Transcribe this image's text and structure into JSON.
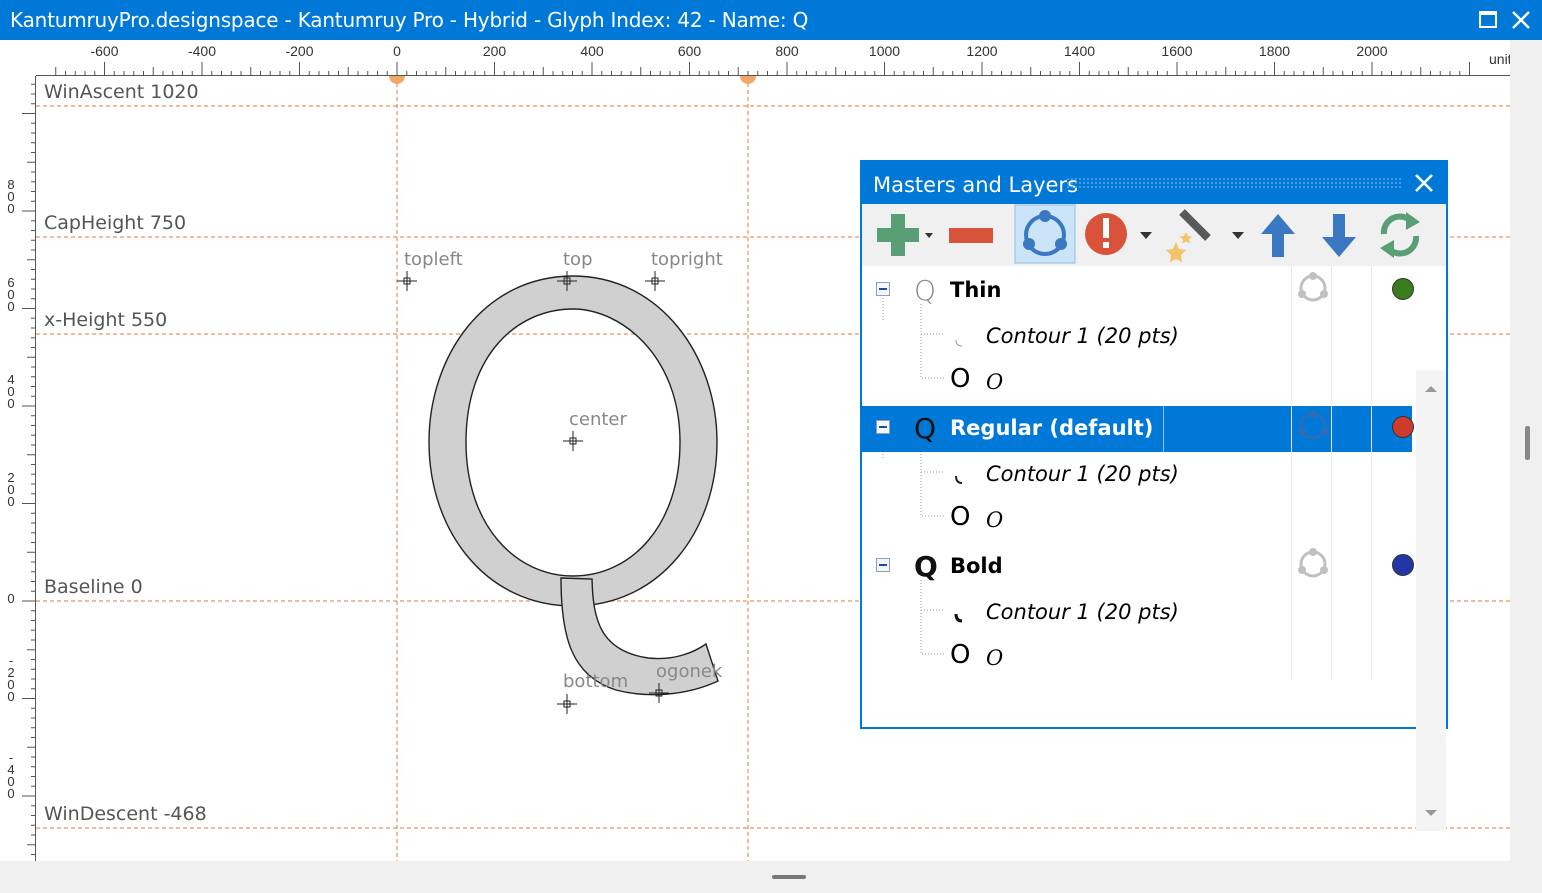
{
  "window": {
    "title": "KantumruyPro.designspace - Kantumruy Pro - Hybrid - Glyph Index: 42 - Name: Q"
  },
  "ruler": {
    "top_labels": [
      "-600",
      "-400",
      "-200",
      "0",
      "200",
      "400",
      "600",
      "800",
      "1000",
      "1200",
      "1400",
      "1600",
      "1800",
      "2000"
    ],
    "units_label": "units",
    "left_labels": [
      "800",
      "600",
      "400",
      "200",
      "0",
      "-200",
      "-400"
    ]
  },
  "metrics": {
    "win_ascent": "WinAscent 1020",
    "cap_height": "CapHeight 750",
    "x_height": "x-Height 550",
    "baseline": "Baseline 0",
    "win_descent": "WinDescent -468"
  },
  "anchors": {
    "topleft": "topleft",
    "top": "top",
    "topright": "topright",
    "center": "center",
    "bottom": "bottom",
    "ogonek": "ogonek"
  },
  "panel": {
    "title": "Masters and Layers",
    "toolbar_icons": [
      "add-icon",
      "remove-icon",
      "master-icon",
      "warning-icon",
      "magic-wand-icon",
      "move-up-icon",
      "move-down-icon",
      "refresh-icon"
    ],
    "masters": [
      {
        "glyph": "Q",
        "name": "Thin",
        "contour": "Contour 1 (20 pts)",
        "component_glyph": "O",
        "component_name": "O",
        "color": "#3a7d1f",
        "selected": false
      },
      {
        "glyph": "Q",
        "name": "Regular (default)",
        "contour": "Contour 1 (20 pts)",
        "component_glyph": "O",
        "component_name": "O",
        "color": "#cc3b2e",
        "selected": true
      },
      {
        "glyph": "Q",
        "name": "Bold",
        "contour": "Contour 1 (20 pts)",
        "component_glyph": "O",
        "component_name": "O",
        "color": "#2236a8",
        "selected": false
      }
    ]
  },
  "colors": {
    "accent": "#0078d7",
    "guide": "#e07a3c",
    "glyph_fill": "#d0d0d0"
  }
}
